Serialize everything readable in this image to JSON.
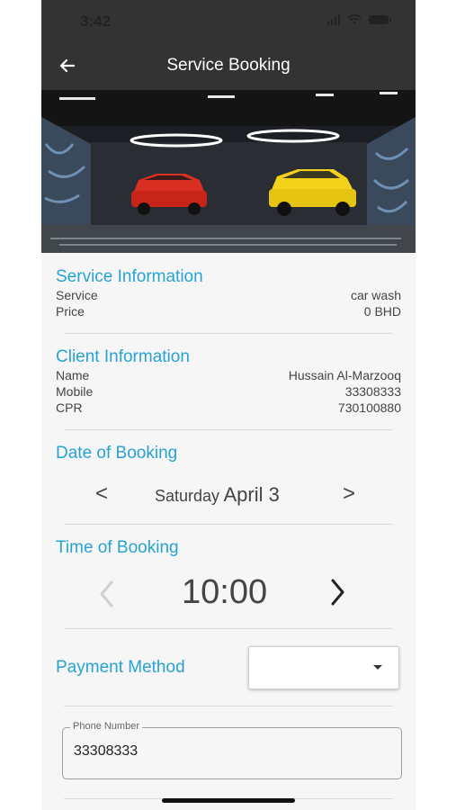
{
  "status_bar": {
    "time": "3:42"
  },
  "app_bar": {
    "title": "Service Booking"
  },
  "service_info": {
    "title": "Service Information",
    "rows": [
      {
        "label": "Service",
        "value": "car wash"
      },
      {
        "label": "Price",
        "value": "0 BHD"
      }
    ]
  },
  "client_info": {
    "title": "Client Information",
    "rows": [
      {
        "label": "Name",
        "value": "Hussain Al-Marzooq"
      },
      {
        "label": "Mobile",
        "value": "33308333"
      },
      {
        "label": "CPR",
        "value": "730100880"
      }
    ]
  },
  "date_booking": {
    "title": "Date of Booking",
    "day": "Saturday",
    "month_day": "April 3",
    "prev": "<",
    "next": ">"
  },
  "time_booking": {
    "title": "Time of Booking",
    "value": "10:00",
    "prev": "‹",
    "next": "›"
  },
  "payment": {
    "title": "Payment Method",
    "selected": ""
  },
  "phone_field": {
    "label": "Phone Number",
    "value": "33308333"
  },
  "colors": {
    "accent": "#27a3d3",
    "appbar": "#333333",
    "background": "#f6f6f6"
  }
}
